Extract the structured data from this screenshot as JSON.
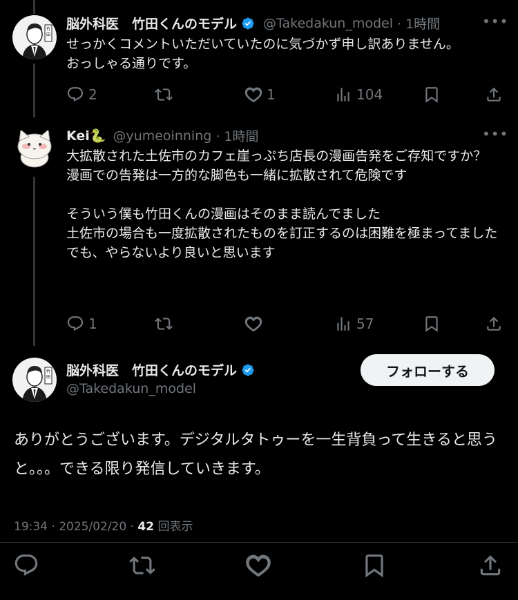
{
  "reply1": {
    "name": "脳外科医　竹田くんのモデル",
    "handle": "@Takedakun_model",
    "time": "· 1時間",
    "text": "せっかくコメントいただいていたのに気づかず申し訳ありません。\nおっしゃる通りです。",
    "replies": "2",
    "retweets": "",
    "likes": "1",
    "views": "104"
  },
  "reply2": {
    "name": "Kei🐍",
    "handle": "@yumeoinning",
    "time": "· 1時間",
    "text": "大拡散された土佐市のカフェ崖っぷち店長の漫画告発をご存知ですか？\n漫画での告発は一方的な脚色も一緒に拡散されて危険です\n\nそういう僕も竹田くんの漫画はそのまま読んでました\n土佐市の場合も一度拡散されたものを訂正するのは困難を極まってました\nでも、やらないより良いと思います",
    "replies": "1",
    "retweets": "",
    "likes": "",
    "views": "57"
  },
  "main": {
    "name": "脳外科医　竹田くんのモデル",
    "handle": "@Takedakun_model",
    "follow_label": "フォローする",
    "text": "ありがとうございます。デジタルタトゥーを一生背負って生きると思うと。。。できる限り発信していきます。",
    "timestamp": "19:34 · 2025/02/20 · ",
    "views_count": "42",
    "views_label": " 回表示"
  },
  "colors": {
    "verified": "#1d9bf0",
    "muted": "#71767b",
    "text": "#e7e9ea"
  }
}
